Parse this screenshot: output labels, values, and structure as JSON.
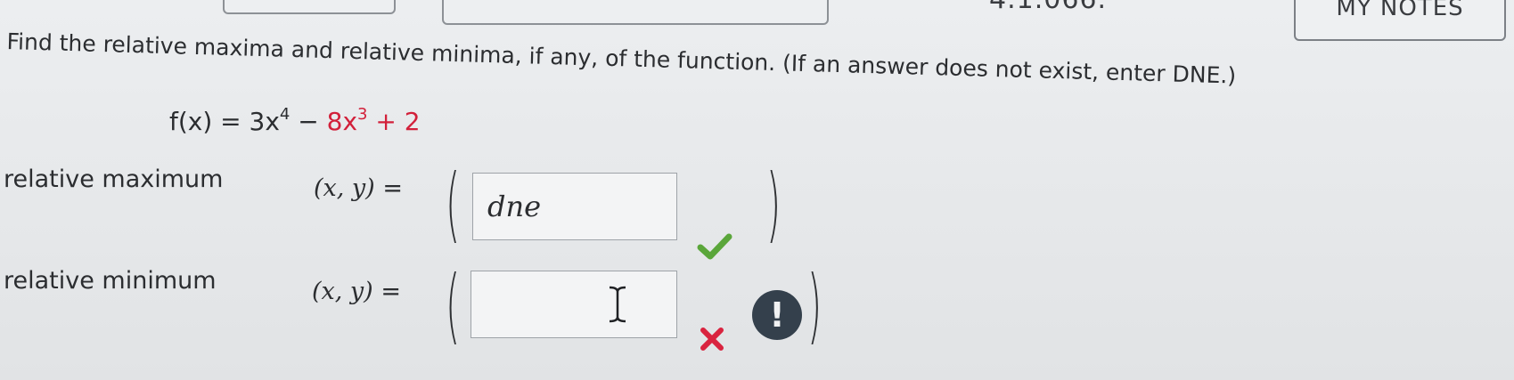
{
  "header": {
    "cut_text": "4.1.066.",
    "notes_button": "MY NOTES"
  },
  "question": {
    "prompt": "Find the relative maxima and relative minima, if any, of the function. (If an answer does not exist, enter DNE.)",
    "function_lhs": "f(x) = 3x",
    "exp1": "4",
    "minus": " − ",
    "term2": "8x",
    "exp2": "3",
    "plus_two": " + 2"
  },
  "rows": {
    "max": {
      "label": "relative maximum",
      "xy": "(x, y)",
      "eq": "=",
      "value": "dne",
      "status": "correct"
    },
    "min": {
      "label": "relative minimum",
      "xy": "(x, y)",
      "eq": "=",
      "value": "",
      "status": "incorrect"
    }
  },
  "colors": {
    "correct": "#5aa63a",
    "incorrect": "#d9233f",
    "alert": "#34404c"
  },
  "icons": {
    "check": "check-icon",
    "x": "x-icon",
    "alert": "exclamation-icon",
    "cursor": "text-cursor-icon"
  }
}
